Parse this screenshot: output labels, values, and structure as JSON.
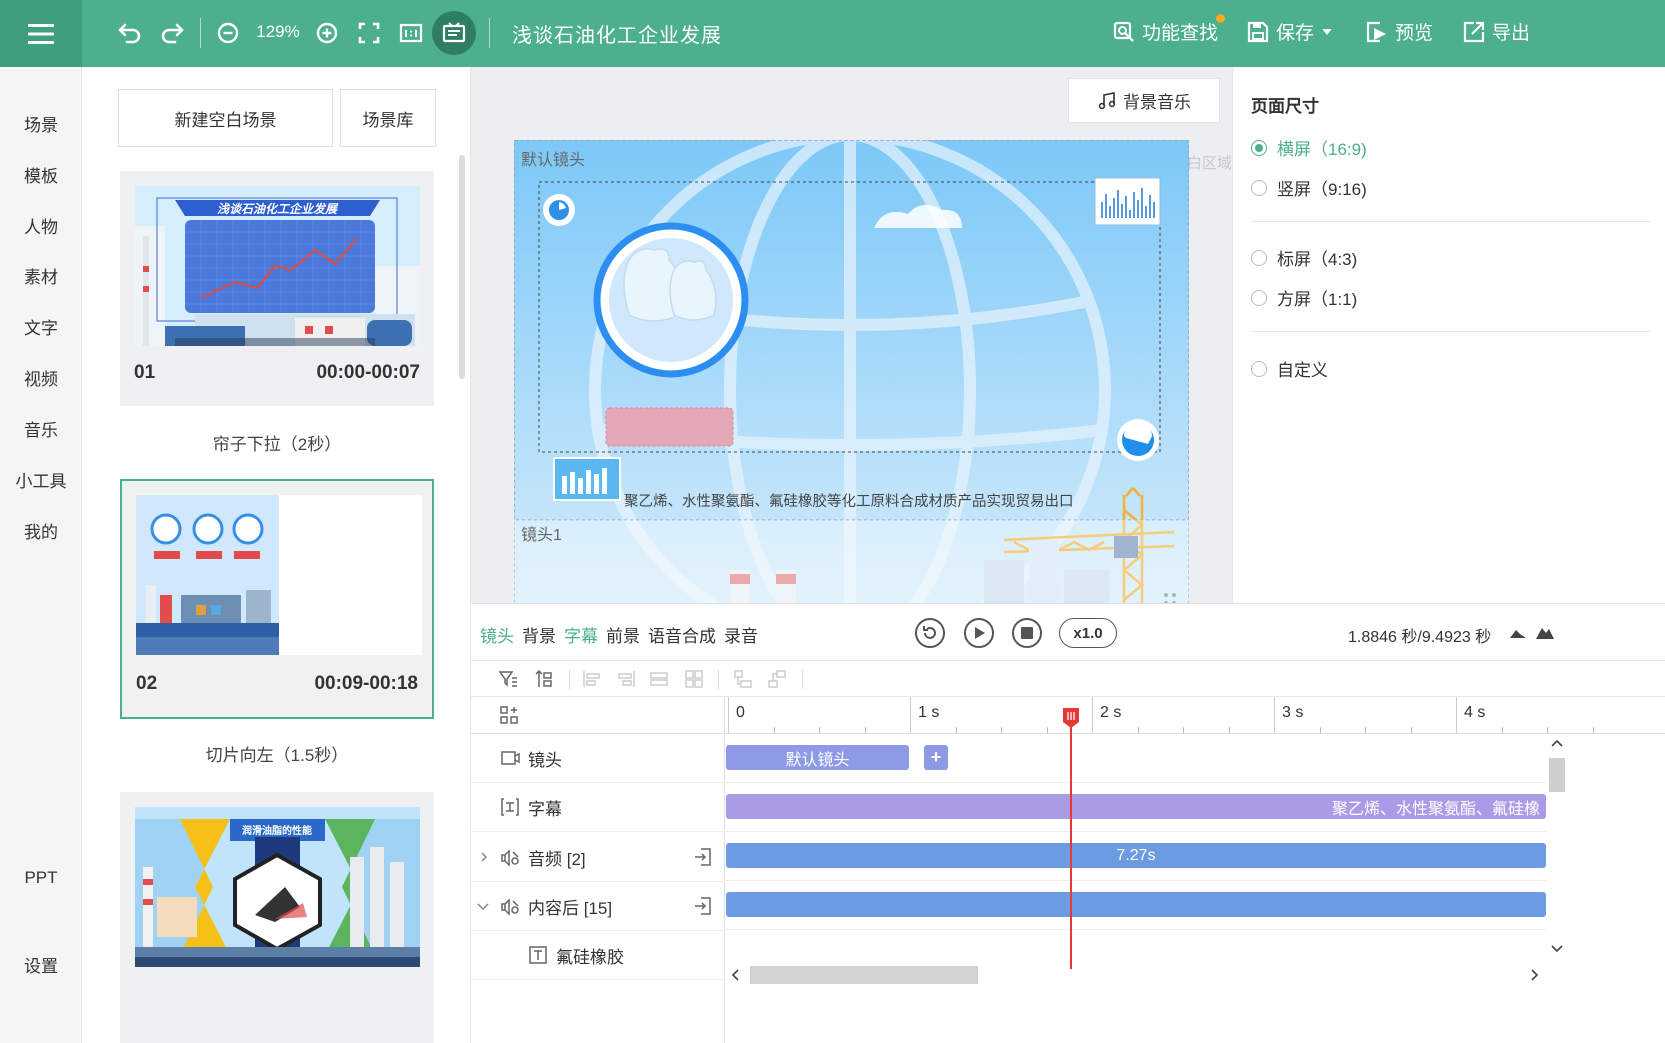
{
  "topbar": {
    "zoom": "129%",
    "title": "浅谈石油化工企业发展",
    "actions": {
      "find": "功能查找",
      "save": "保存",
      "preview": "预览",
      "export": "导出"
    },
    "colors": {
      "bar": "#4caf8e",
      "menu": "#3f9e7e",
      "notify": "#ffa726"
    }
  },
  "leftnav": {
    "items": [
      "场景",
      "模板",
      "人物",
      "素材",
      "文字",
      "视频",
      "音乐",
      "小工具",
      "我的"
    ],
    "bottom": [
      "PPT",
      "设置"
    ]
  },
  "scenes": {
    "new_blank": "新建空白场景",
    "library": "场景库",
    "list": [
      {
        "num": "01",
        "time": "00:00-00:07",
        "thumb_title": "浅谈石油化工企业发展",
        "transition": "帘子下拉（2秒）"
      },
      {
        "num": "02",
        "time": "00:09-00:18",
        "transition": "切片向左（1.5秒）",
        "selected": true
      },
      {
        "thumb_title": "润滑油脂的性能"
      }
    ]
  },
  "canvas": {
    "bgm_button": "背景音乐",
    "camera_default": "默认镜头",
    "camera_1": "镜头1",
    "blank_area": "白区域",
    "subtitle": "聚乙烯、水性聚氨酯、氟硅橡胶等化工原料合成材质产品实现贸易出口"
  },
  "page_size": {
    "title": "页面尺寸",
    "options": [
      {
        "label": "横屏（16:9)",
        "checked": true
      },
      {
        "label": "竖屏（9:16)",
        "checked": false
      },
      {
        "label": "标屏（4:3)",
        "checked": false
      },
      {
        "label": "方屏（1:1)",
        "checked": false
      },
      {
        "label": "自定义",
        "checked": false
      }
    ],
    "accent": "#4caf8e"
  },
  "timeline": {
    "tabs": [
      {
        "label": "镜头",
        "active": true
      },
      {
        "label": "背景",
        "active": false
      },
      {
        "label": "字幕",
        "active": true
      },
      {
        "label": "前景",
        "active": false
      },
      {
        "label": "语音合成",
        "active": false
      },
      {
        "label": "录音",
        "active": false
      }
    ],
    "speed": "x1.0",
    "time_readout": "1.8846 秒/9.4923 秒",
    "current_time_s": 1.8846,
    "total_time_s": 9.4923,
    "ruler": [
      "0",
      "1 s",
      "2 s",
      "3 s",
      "4 s"
    ],
    "tracks": [
      {
        "label": "镜头"
      },
      {
        "label": "字幕"
      },
      {
        "label": "音频 [2]"
      },
      {
        "label": "内容后 [15]"
      },
      {
        "label": "氟硅橡胶"
      }
    ],
    "clips": {
      "camera": "默认镜头",
      "camera_add": "+",
      "subtitle": "聚乙烯、水性聚氨酯、氟硅橡",
      "audio": "7.27s"
    },
    "colors": {
      "camera_clip": "#8f9ae6",
      "subtitle_clip": "#ab9be6",
      "audio_clip": "#6b9be0",
      "playhead": "#e53935"
    }
  }
}
